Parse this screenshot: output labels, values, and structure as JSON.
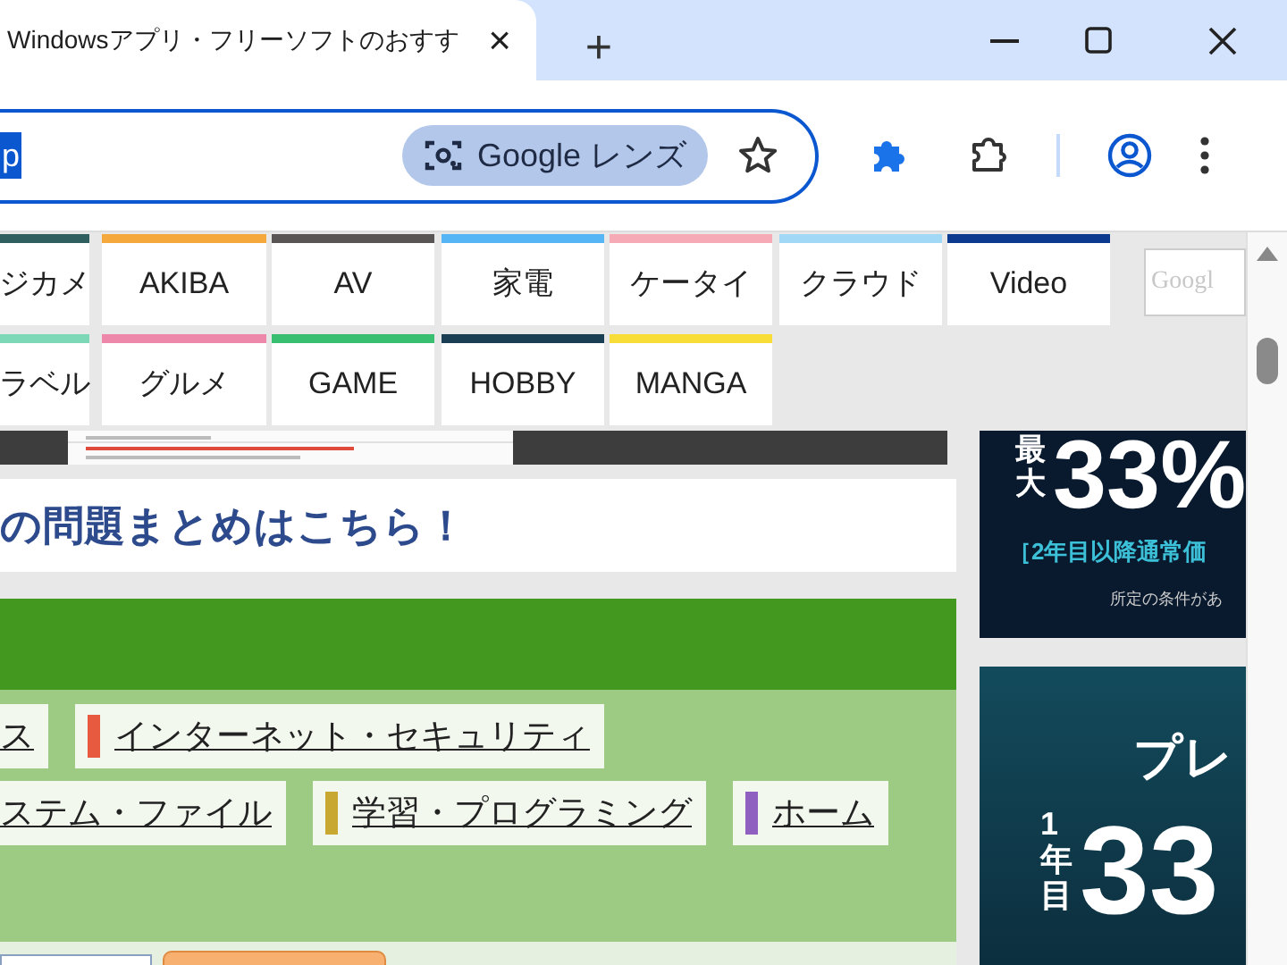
{
  "browser": {
    "tab": {
      "title": "Windowsアプリ・フリーソフトのおすす",
      "close": "×"
    },
    "new_tab": "+",
    "address": {
      "selected_text": "p",
      "lens": "Google レンズ"
    }
  },
  "nav": {
    "rows": [
      [
        {
          "label": "ジカメ",
          "color": "#2f5f5f"
        },
        {
          "label": "AKIBA",
          "color": "#f5a83c"
        },
        {
          "label": "AV",
          "color": "#5a5555"
        },
        {
          "label": "家電",
          "color": "#56b6f5"
        },
        {
          "label": "ケータイ",
          "color": "#f5aab5"
        },
        {
          "label": "クラウド",
          "color": "#a0d8f5"
        },
        {
          "label": "Video",
          "color": "#0b3a8f"
        }
      ],
      [
        {
          "label": "ラベル",
          "color": "#7dd8b8"
        },
        {
          "label": "グルメ",
          "color": "#ee88aa"
        },
        {
          "label": "GAME",
          "color": "#38c070"
        },
        {
          "label": "HOBBY",
          "color": "#1a3f55"
        },
        {
          "label": "MANGA",
          "color": "#f8dc38"
        }
      ]
    ],
    "search_logo": "Googl"
  },
  "heading": "の問題まとめはこちら！",
  "categories": [
    [
      {
        "label": "ス"
      },
      {
        "label": "インターネット・セキュリティ",
        "color": "#e85a40"
      }
    ],
    [
      {
        "label": "ステム・ファイル"
      },
      {
        "label": "学習・プログラミング",
        "color": "#c8a830"
      },
      {
        "label": "ホーム",
        "color": "#9060c0"
      }
    ]
  ],
  "ads": [
    {
      "lines": [
        "最大",
        "33%",
        "［2年目以降通常価",
        "所定の条件があ"
      ]
    },
    {
      "lines": [
        "プレ",
        "1年目",
        "33"
      ]
    }
  ]
}
